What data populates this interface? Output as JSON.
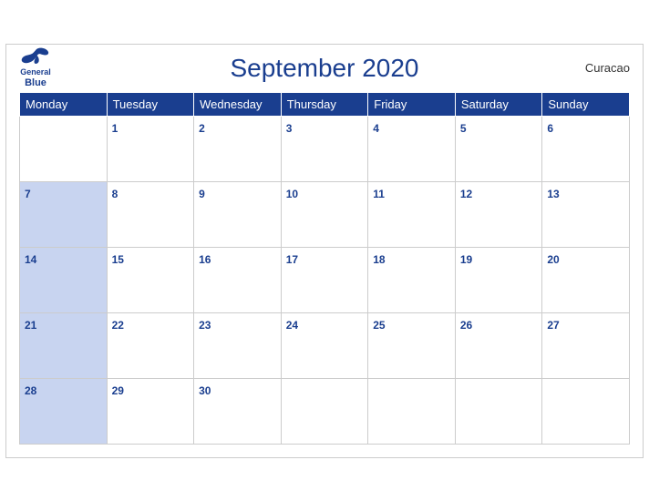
{
  "header": {
    "title": "September 2020",
    "region": "Curacao",
    "logo": {
      "line1": "General",
      "line2": "Blue"
    }
  },
  "weekdays": [
    "Monday",
    "Tuesday",
    "Wednesday",
    "Thursday",
    "Friday",
    "Saturday",
    "Sunday"
  ],
  "weeks": [
    [
      {
        "day": "",
        "header": false
      },
      {
        "day": "1",
        "header": false
      },
      {
        "day": "2",
        "header": false
      },
      {
        "day": "3",
        "header": false
      },
      {
        "day": "4",
        "header": false
      },
      {
        "day": "5",
        "header": false
      },
      {
        "day": "6",
        "header": false
      }
    ],
    [
      {
        "day": "7",
        "header": true
      },
      {
        "day": "8",
        "header": false
      },
      {
        "day": "9",
        "header": false
      },
      {
        "day": "10",
        "header": false
      },
      {
        "day": "11",
        "header": false
      },
      {
        "day": "12",
        "header": false
      },
      {
        "day": "13",
        "header": false
      }
    ],
    [
      {
        "day": "14",
        "header": true
      },
      {
        "day": "15",
        "header": false
      },
      {
        "day": "16",
        "header": false
      },
      {
        "day": "17",
        "header": false
      },
      {
        "day": "18",
        "header": false
      },
      {
        "day": "19",
        "header": false
      },
      {
        "day": "20",
        "header": false
      }
    ],
    [
      {
        "day": "21",
        "header": true
      },
      {
        "day": "22",
        "header": false
      },
      {
        "day": "23",
        "header": false
      },
      {
        "day": "24",
        "header": false
      },
      {
        "day": "25",
        "header": false
      },
      {
        "day": "26",
        "header": false
      },
      {
        "day": "27",
        "header": false
      }
    ],
    [
      {
        "day": "28",
        "header": true
      },
      {
        "day": "29",
        "header": false
      },
      {
        "day": "30",
        "header": false
      },
      {
        "day": "",
        "header": false
      },
      {
        "day": "",
        "header": false
      },
      {
        "day": "",
        "header": false
      },
      {
        "day": "",
        "header": false
      }
    ]
  ]
}
